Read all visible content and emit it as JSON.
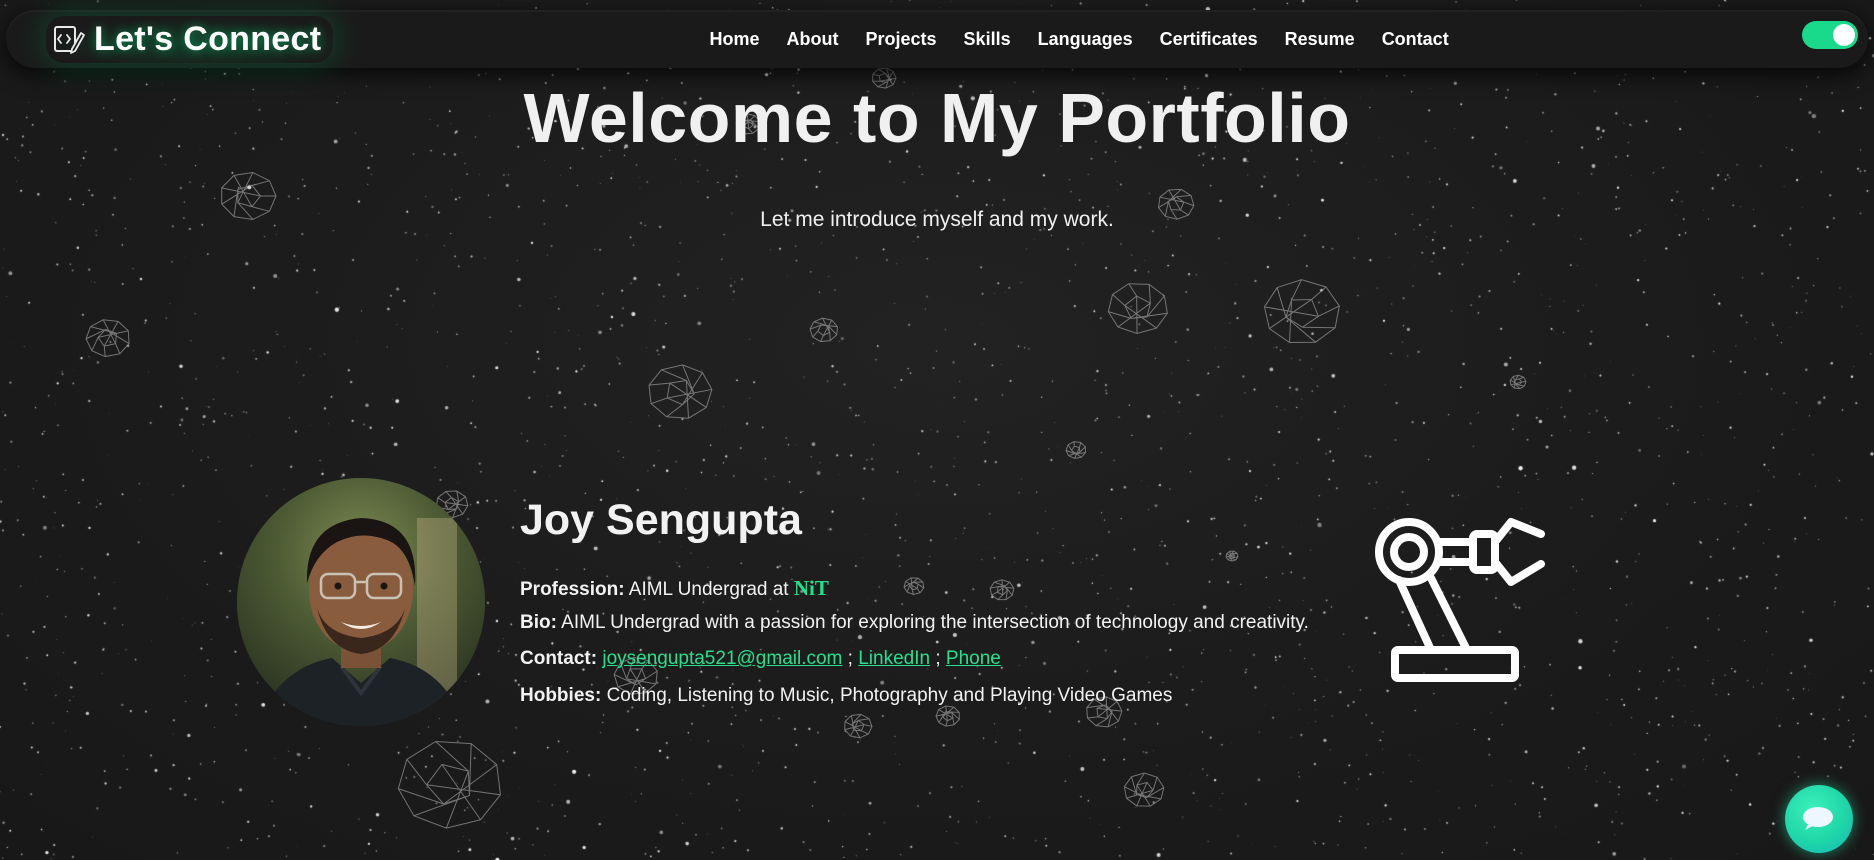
{
  "brand": {
    "title": "Let's Connect",
    "icon": "code-edit-icon"
  },
  "nav": {
    "items": [
      "Home",
      "About",
      "Projects",
      "Skills",
      "Languages",
      "Certificates",
      "Resume",
      "Contact"
    ]
  },
  "theme_toggle": {
    "state": "on",
    "color": "#19d98b"
  },
  "hero": {
    "title": "Welcome to My Portfolio",
    "subtitle": "Let me introduce myself and my work."
  },
  "profile": {
    "name": "Joy Sengupta",
    "profession_label": "Profession:",
    "profession_text": "AIML Undergrad at",
    "institution": "NiT",
    "bio_label": "Bio:",
    "bio_text": "AIML Undergrad with a passion for exploring the intersection of technology and creativity.",
    "contact_label": "Contact:",
    "email": "joysengupta521@gmail.com",
    "separator": ";",
    "linkedin": "LinkedIn",
    "phone": "Phone",
    "hobbies_label": "Hobbies:",
    "hobbies_text": "Coding, Listening to Music, Photography and Playing Video Games",
    "avatar": "profile-photo",
    "side_icon": "robot-arm-icon"
  },
  "chat": {
    "icon": "chat-bubble-icon"
  },
  "colors": {
    "background": "#1b1b1b",
    "accent": "#22e08c",
    "text": "#f0f0f0"
  }
}
